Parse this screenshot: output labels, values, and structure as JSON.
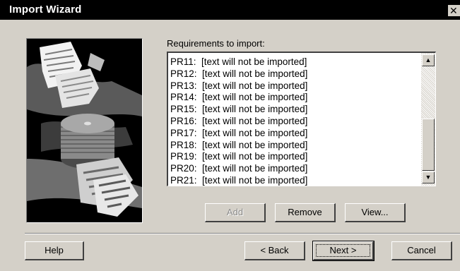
{
  "window": {
    "title": "Import Wizard",
    "close_glyph": "✕"
  },
  "requirements": {
    "label": "Requirements to import:",
    "items": [
      {
        "id": "PR11:",
        "text": "[text will not be imported]"
      },
      {
        "id": "PR12:",
        "text": "[text will not be imported]"
      },
      {
        "id": "PR13:",
        "text": "[text will not be imported]"
      },
      {
        "id": "PR14:",
        "text": "[text will not be imported]"
      },
      {
        "id": "PR15:",
        "text": "[text will not be imported]"
      },
      {
        "id": "PR16:",
        "text": "[text will not be imported]"
      },
      {
        "id": "PR17:",
        "text": "[text will not be imported]"
      },
      {
        "id": "PR18:",
        "text": "[text will not be imported]"
      },
      {
        "id": "PR19:",
        "text": "[text will not be imported]"
      },
      {
        "id": "PR20:",
        "text": "[text will not be imported]"
      },
      {
        "id": "PR21:",
        "text": "[text will not be imported]"
      }
    ]
  },
  "list_actions": {
    "add": "Add",
    "remove": "Remove",
    "view": "View..."
  },
  "footer": {
    "help": "Help",
    "back": "< Back",
    "next": "Next >",
    "cancel": "Cancel"
  },
  "icons": {
    "scroll_up": "up-arrow-icon",
    "scroll_down": "down-arrow-icon"
  }
}
